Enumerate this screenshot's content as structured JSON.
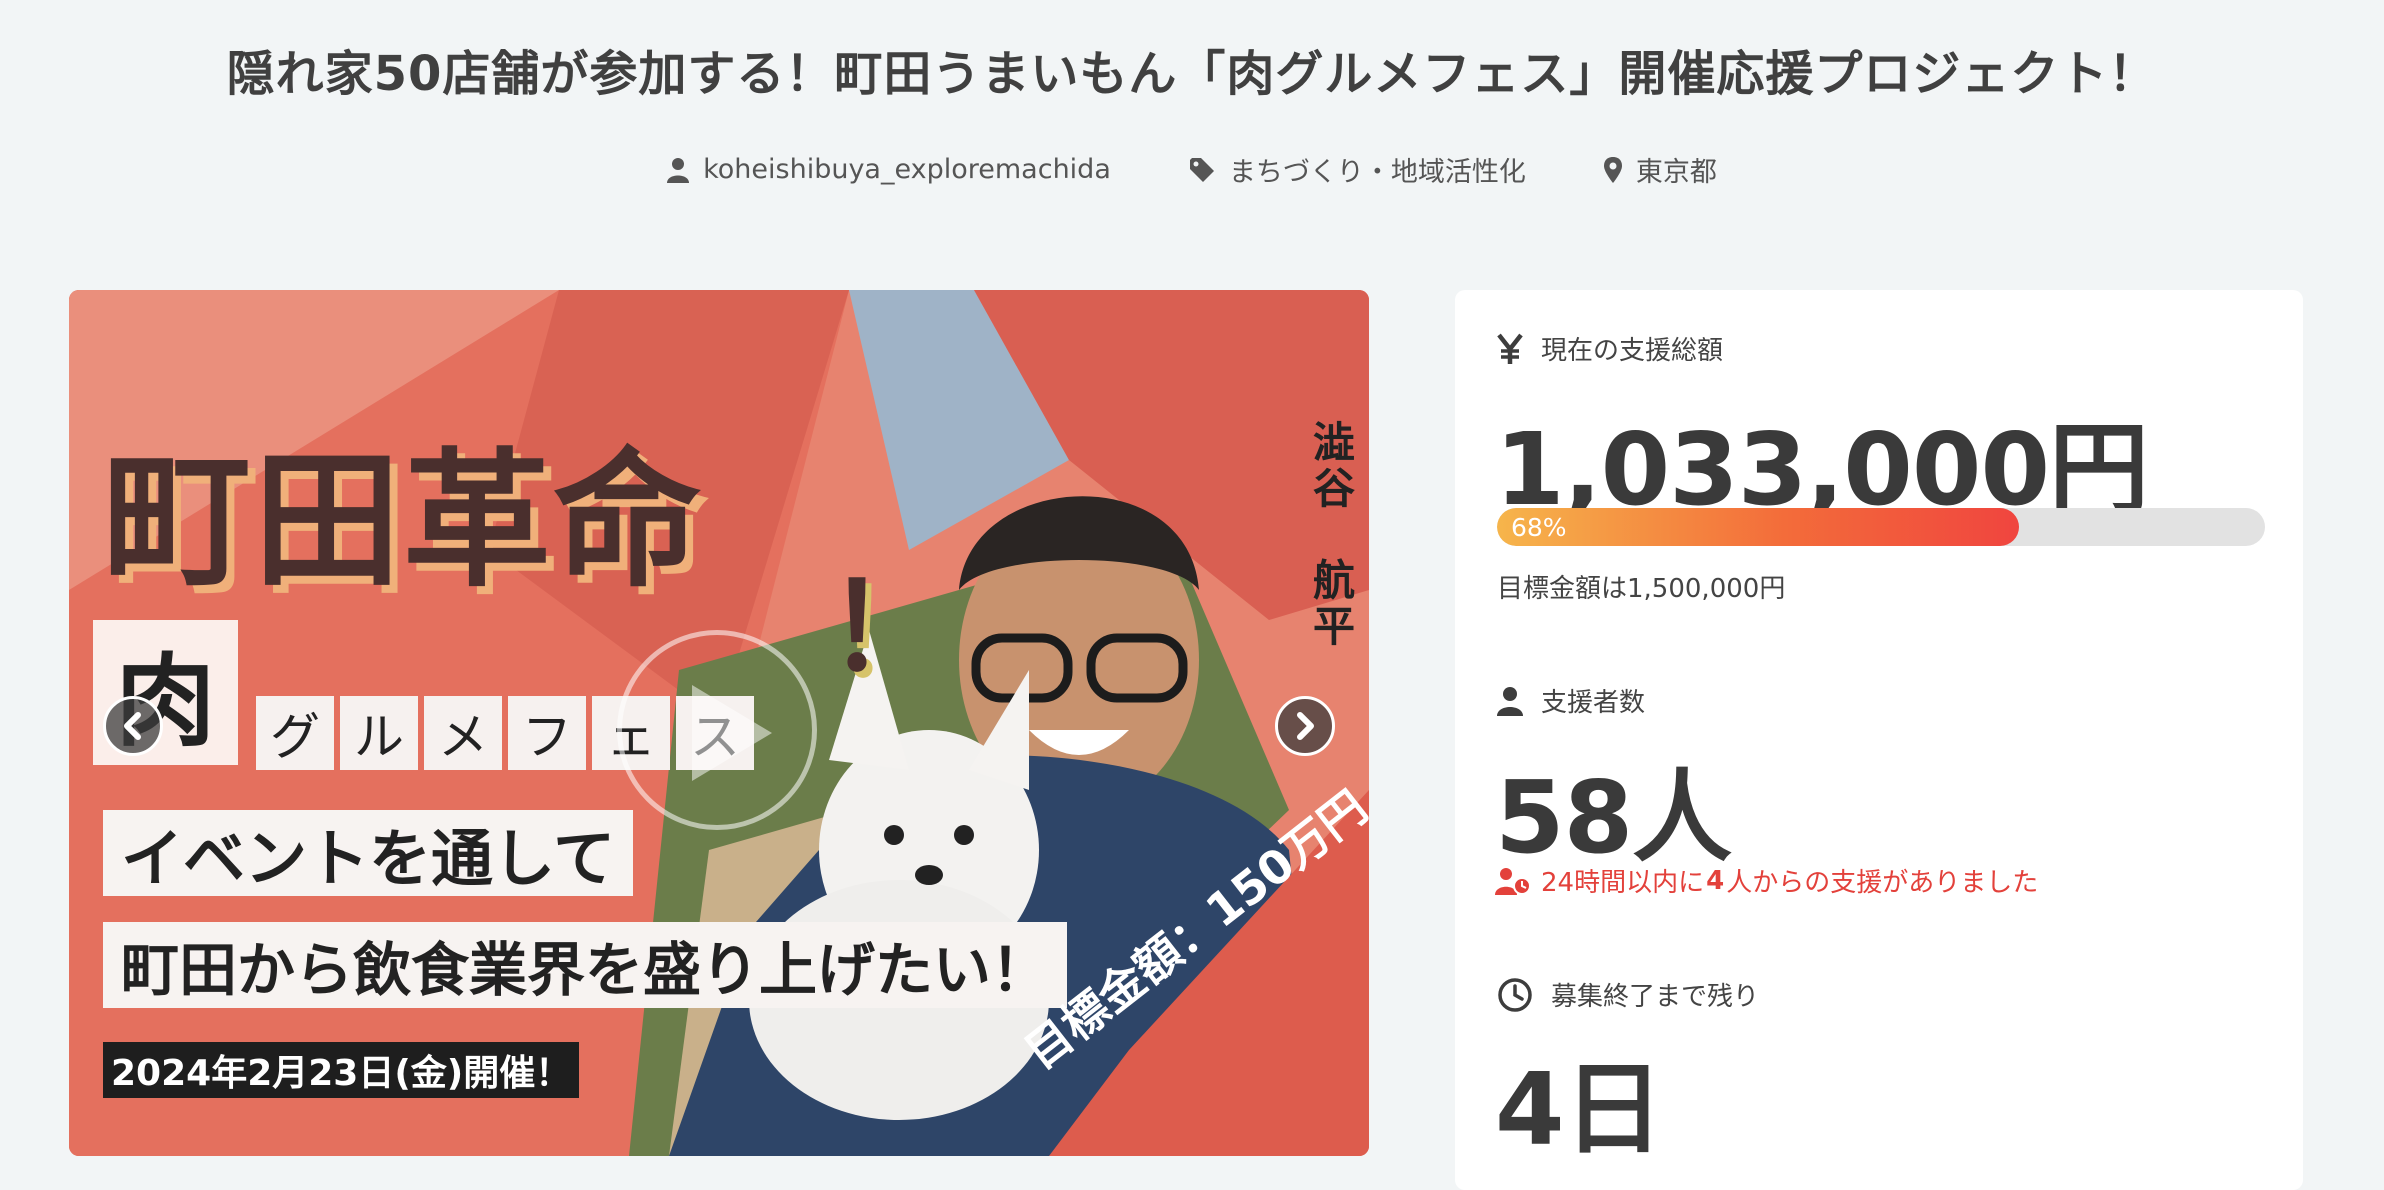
{
  "project": {
    "title": "隠れ家50店舗が参加する！町田うまいもん「肉グルメフェス」開催応援プロジェクト！",
    "owner": "koheishibuya_exploremachida",
    "category": "まちづくり・地域活性化",
    "location": "東京都"
  },
  "hero": {
    "headline": "町田革命",
    "exclamation": "！",
    "niku": "肉",
    "gourmet_chars": [
      "グ",
      "ル",
      "メ",
      "フ",
      "ェ",
      "ス"
    ],
    "line1": "イベントを通して",
    "line2": "町田から飲食業界を盛り上げたい！",
    "date": "2024年2月23日(金)開催！",
    "name_top": "澁谷",
    "name_bottom": "航平",
    "goal_diagonal": "目標金額：150万円"
  },
  "stats": {
    "total_label": "現在の支援総額",
    "total_amount": "1,033,000円",
    "progress_percent": 68,
    "progress_label": "68%",
    "goal_text": "目標金額は1,500,000円",
    "backers_label": "支援者数",
    "backers_count": "58人",
    "recent_prefix": "24時間以内に",
    "recent_count": "4",
    "recent_suffix": "人からの支援がありました",
    "remaining_label": "募集終了まで残り",
    "remaining_days": "4日"
  },
  "colors": {
    "background": "#f2f5f6",
    "accent_red": "#e3413b",
    "progress_start": "#f6b54b",
    "progress_end": "#f0453f"
  },
  "icons": [
    "user-icon",
    "tag-icon",
    "map-pin-icon",
    "yen-icon",
    "user-icon",
    "user-clock-icon",
    "clock-icon",
    "chevron-left-icon",
    "chevron-right-icon",
    "play-icon"
  ]
}
